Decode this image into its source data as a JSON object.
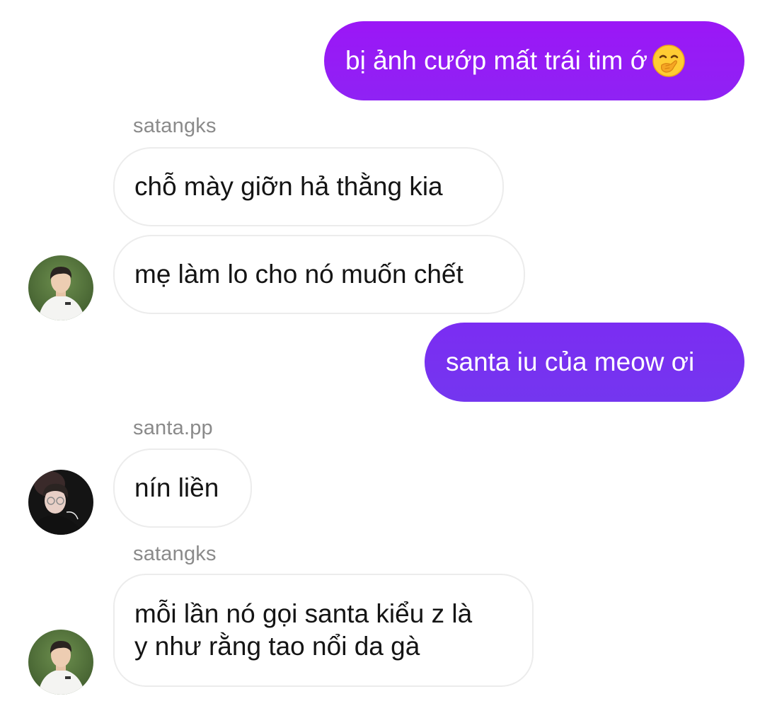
{
  "colors": {
    "sent_gradient_top": "#9b1ff5",
    "sent_gradient_bottom": "#7a35f0",
    "sender_name": "#8a8a8a",
    "received_border": "#ececec"
  },
  "messages": [
    {
      "type": "sent",
      "text": "bị ảnh cướp mất trái tim ớ",
      "emoji": "hand-over-mouth-emoji"
    },
    {
      "type": "sender_label",
      "text": "satangks"
    },
    {
      "type": "received",
      "text": "chỗ mày giỡn hả thằng kia"
    },
    {
      "type": "received",
      "text": "mẹ làm lo cho nó muốn chết",
      "avatar": "avatar-satangks"
    },
    {
      "type": "sent",
      "text": "santa iu của meow ơi"
    },
    {
      "type": "sender_label",
      "text": "santa.pp"
    },
    {
      "type": "received",
      "text": "nín liền",
      "avatar": "avatar-santa"
    },
    {
      "type": "sender_label",
      "text": "satangks"
    },
    {
      "type": "received",
      "lines": [
        "mỗi lần nó gọi santa kiểu z là",
        "y như rằng tao nổi da gà"
      ],
      "avatar": "avatar-satangks"
    }
  ]
}
